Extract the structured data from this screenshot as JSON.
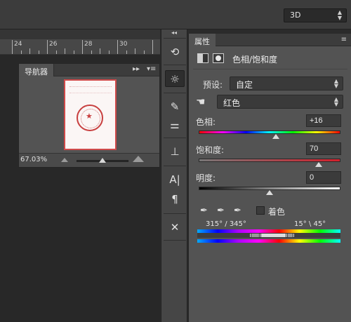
{
  "topbar": {
    "workspace": "3D"
  },
  "ruler": {
    "labels": [
      "24",
      "26",
      "28",
      "30"
    ]
  },
  "navigator": {
    "title": "导航器",
    "zoom": "67.03%",
    "zoom_slider_fraction": 0.43
  },
  "toolstrip": {
    "icons": [
      "history-icon",
      "adjustments-icon",
      "brush-presets-icon",
      "brush-icon",
      "clone-source-icon",
      "character-icon",
      "paragraph-icon",
      "tool-presets-icon"
    ]
  },
  "properties": {
    "tab": "属性",
    "adjustment_title": "色相/饱和度",
    "preset_label": "预设:",
    "preset_value": "自定",
    "channel_value": "红色",
    "hue": {
      "label": "色相:",
      "value": "+16",
      "min": -180,
      "max": 180
    },
    "saturation": {
      "label": "饱和度:",
      "value": "70",
      "min": -100,
      "max": 100
    },
    "lightness": {
      "label": "明度:",
      "value": "0",
      "min": -100,
      "max": 100
    },
    "colorize_label": "着色",
    "colorize_checked": false,
    "range_left": "315° / 345°",
    "range_right": "15° \\ 45°"
  }
}
